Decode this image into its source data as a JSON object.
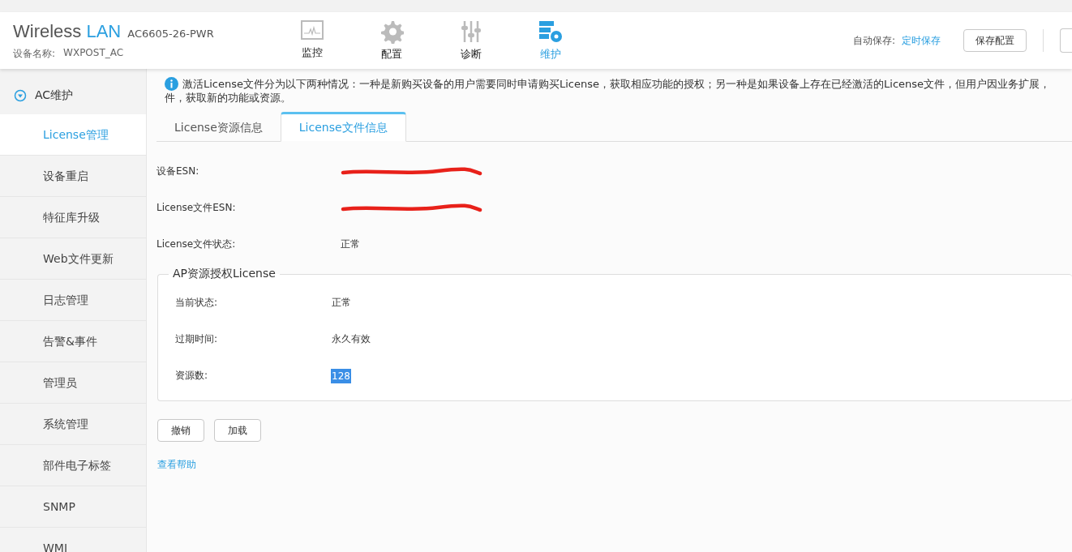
{
  "header": {
    "brand": "Wireless",
    "brand_accent": "LAN",
    "model": "AC6605-26-PWR",
    "device_label": "设备名称:",
    "device_name": "WXPOST_AC",
    "nav": [
      {
        "label": "监控",
        "selected": false
      },
      {
        "label": "配置",
        "selected": false
      },
      {
        "label": "诊断",
        "selected": false
      },
      {
        "label": "维护",
        "selected": true
      }
    ],
    "autosave_label": "自动保存:",
    "autosave_link": "定时保存",
    "save_button": "保存配置"
  },
  "sidebar": {
    "group": {
      "label": "AC维护",
      "expanded": true
    },
    "items": [
      {
        "label": "License管理",
        "selected": true
      },
      {
        "label": "设备重启",
        "selected": false
      },
      {
        "label": "特征库升级",
        "selected": false
      },
      {
        "label": "Web文件更新",
        "selected": false
      },
      {
        "label": "日志管理",
        "selected": false
      },
      {
        "label": "告警&事件",
        "selected": false
      },
      {
        "label": "管理员",
        "selected": false
      },
      {
        "label": "系统管理",
        "selected": false
      },
      {
        "label": "部件电子标签",
        "selected": false
      },
      {
        "label": "SNMP",
        "selected": false
      },
      {
        "label": "WMI",
        "selected": false
      }
    ]
  },
  "notice": [
    "激活License文件分为以下两种情况：一种是新购买设备的用户需要同时申请购买License，获取相应功能的授权；另一种是如果设备上存在已经激活的License文件，但用户因业务扩展，",
    "件，获取新的功能或资源。"
  ],
  "tabs": [
    {
      "label": "License资源信息",
      "selected": false
    },
    {
      "label": "License文件信息",
      "selected": true
    }
  ],
  "fields": [
    {
      "label": "设备ESN:",
      "kind": "redacted"
    },
    {
      "label": "License文件ESN:",
      "kind": "redacted"
    },
    {
      "label": "License文件状态:",
      "kind": "text",
      "value": "正常"
    }
  ],
  "group": {
    "title": "AP资源授权License",
    "fields": [
      {
        "label": "当前状态:",
        "value": "正常",
        "highlighted": false
      },
      {
        "label": "过期时间:",
        "value": "永久有效",
        "highlighted": false
      },
      {
        "label": "资源数:",
        "value": "128",
        "highlighted": true
      }
    ]
  },
  "buttons": [
    "撤销",
    "加载"
  ],
  "help_link": "查看帮助"
}
